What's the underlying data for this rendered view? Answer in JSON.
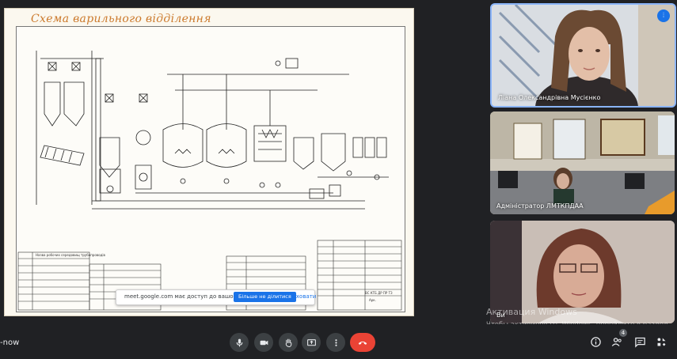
{
  "slide": {
    "title": "Схема варильного відділення",
    "stamp_text": "ВС КТБ ДР ПР ТЗ",
    "stamp_sub": "Арк.",
    "table_header": "Назва робочих середовищ трубопроводів"
  },
  "share_bar": {
    "message": "meet.google.com має доступ до вашого екрана.",
    "stop_label": "Більше не ділитися",
    "hide_label": "Сховати"
  },
  "participants": [
    {
      "name": "Ліана Олександрівна Мусієнко",
      "speaking": true
    },
    {
      "name": "Адміністратор ЛМТКПДАА",
      "speaking": false
    },
    {
      "name": "Ви",
      "speaking": false
    }
  ],
  "watermark": {
    "title": "Активация Windows",
    "text": "Чтобы активировать Windows, перейдите в раздел \"Параметры\"."
  },
  "bottom": {
    "meeting_code": "-now",
    "people_count": "4"
  },
  "colors": {
    "end_call": "#ea4335",
    "accent": "#1a73e8",
    "title": "#cc7a2d"
  }
}
